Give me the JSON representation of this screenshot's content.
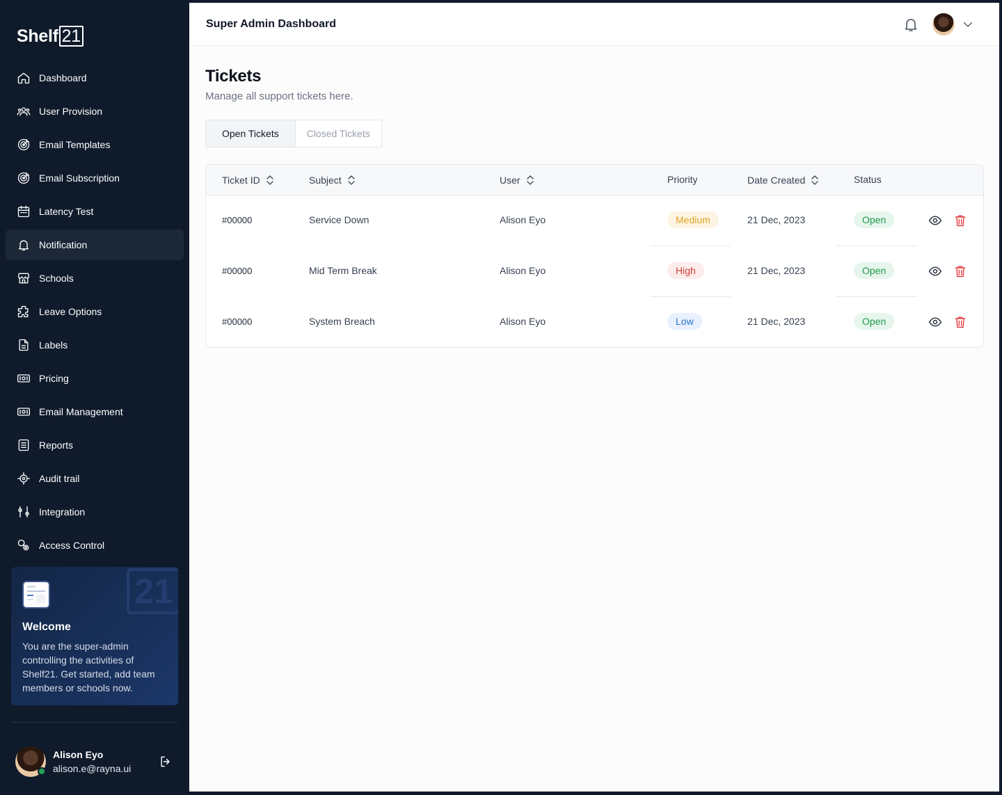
{
  "brand": {
    "name": "Shelf",
    "box": "21"
  },
  "sidebar": {
    "items": [
      {
        "label": "Dashboard",
        "icon": "home-icon"
      },
      {
        "label": "User Provision",
        "icon": "users-icon"
      },
      {
        "label": "Email Templates",
        "icon": "target-icon"
      },
      {
        "label": "Email Subscription",
        "icon": "target-icon"
      },
      {
        "label": "Latency Test",
        "icon": "calendar-icon"
      },
      {
        "label": "Notification",
        "icon": "bell-icon",
        "active": true
      },
      {
        "label": "Schools",
        "icon": "store-icon"
      },
      {
        "label": "Leave Options",
        "icon": "puzzle-icon"
      },
      {
        "label": "Labels",
        "icon": "document-icon"
      },
      {
        "label": "Pricing",
        "icon": "money-icon"
      },
      {
        "label": "Email Management",
        "icon": "money-icon"
      },
      {
        "label": "Reports",
        "icon": "list-icon"
      },
      {
        "label": "Audit trail",
        "icon": "crosshair-icon"
      },
      {
        "label": "Integration",
        "icon": "sliders-icon"
      },
      {
        "label": "Access Control",
        "icon": "key-icon"
      }
    ]
  },
  "welcome": {
    "watermark": "21",
    "title": "Welcome",
    "text": "You are the super-admin controlling the activities of Shelf21. Get started, add team members or schools now."
  },
  "profile": {
    "name": "Alison Eyo",
    "email": "alison.e@rayna.ui"
  },
  "header": {
    "title": "Super Admin Dashboard"
  },
  "page": {
    "title": "Tickets",
    "subtitle": "Manage all support tickets here."
  },
  "tabs": [
    {
      "label": "Open Tickets",
      "active": true
    },
    {
      "label": "Closed Tickets",
      "active": false
    }
  ],
  "table": {
    "columns": [
      "Ticket ID",
      "Subject",
      "User",
      "Priority",
      "Date Created",
      "Status"
    ],
    "rows": [
      {
        "id": "#00000",
        "subject": "Service Down",
        "user": "Alison Eyo",
        "priority": "Medium",
        "date": "21 Dec, 2023",
        "status": "Open"
      },
      {
        "id": "#00000",
        "subject": "Mid Term Break",
        "user": "Alison Eyo",
        "priority": "High",
        "date": "21 Dec, 2023",
        "status": "Open"
      },
      {
        "id": "#00000",
        "subject": "System Breach",
        "user": "Alison Eyo",
        "priority": "Low",
        "date": "21 Dec, 2023",
        "status": "Open"
      }
    ]
  },
  "colors": {
    "sidebar_bg": "#0f1a2b",
    "medium": "#e0a526",
    "high": "#d63b3b",
    "low": "#2f74d0",
    "open": "#1f9a4a",
    "delete": "#e53e3e"
  }
}
